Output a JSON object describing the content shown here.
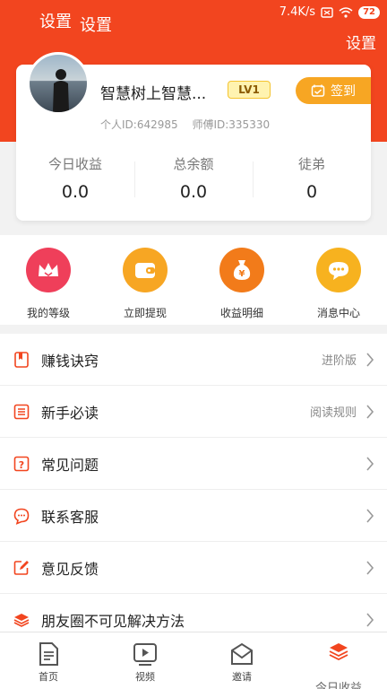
{
  "status_bar": {
    "title_a": "设置",
    "title_b": "设置",
    "network_speed": "7.4K/s",
    "battery": "72"
  },
  "header": {
    "settings_label": "设置"
  },
  "profile": {
    "username": "智慧树上智慧...",
    "level": "LV1",
    "checkin_label": "签到",
    "personal_id": "个人ID:642985",
    "mentor_id": "师傅ID:335330",
    "stats": [
      {
        "label": "今日收益",
        "value": "0.0"
      },
      {
        "label": "总余额",
        "value": "0.0"
      },
      {
        "label": "徒弟",
        "value": "0"
      }
    ]
  },
  "actions": [
    {
      "label": "我的等级",
      "icon": "crown-icon",
      "color": "#ef3f5a"
    },
    {
      "label": "立即提现",
      "icon": "wallet-icon",
      "color": "#f7a623"
    },
    {
      "label": "收益明细",
      "icon": "money-bag-icon",
      "color": "#f27b1a"
    },
    {
      "label": "消息中心",
      "icon": "chat-bubble-icon",
      "color": "#f7b21f"
    }
  ],
  "menu": [
    {
      "label": "赚钱诀窍",
      "extra": "进阶版",
      "icon": "book-icon"
    },
    {
      "label": "新手必读",
      "extra": "阅读规则",
      "icon": "list-icon"
    },
    {
      "label": "常见问题",
      "extra": "",
      "icon": "question-icon"
    },
    {
      "label": "联系客服",
      "extra": "",
      "icon": "chat-icon"
    },
    {
      "label": "意见反馈",
      "extra": "",
      "icon": "edit-icon"
    },
    {
      "label": "朋友圈不可见解决方法",
      "extra": "",
      "icon": "layers-icon"
    }
  ],
  "nav": [
    {
      "label": "首页",
      "icon": "document-icon"
    },
    {
      "label": "视频",
      "icon": "video-icon"
    },
    {
      "label": "邀请",
      "icon": "envelope-icon"
    },
    {
      "label": "今日收益",
      "icon": "layers-icon"
    }
  ],
  "colors": {
    "brand": "#f2451f",
    "accent": "#f7a623",
    "badge_bg": "#fff3b0"
  }
}
